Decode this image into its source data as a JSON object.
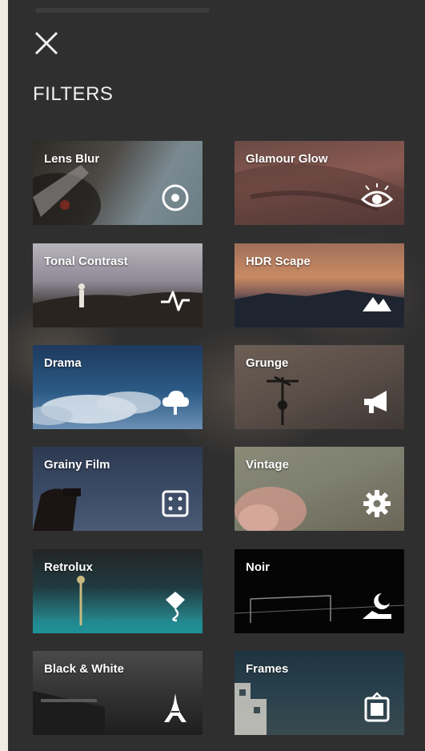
{
  "header": {
    "title": "FILTERS"
  },
  "filters": [
    {
      "label": "Lens Blur",
      "icon": "target-icon"
    },
    {
      "label": "Glamour Glow",
      "icon": "eye-icon"
    },
    {
      "label": "Tonal Contrast",
      "icon": "pulse-icon"
    },
    {
      "label": "HDR Scape",
      "icon": "mountains-icon"
    },
    {
      "label": "Drama",
      "icon": "cloud-icon"
    },
    {
      "label": "Grunge",
      "icon": "megaphone-icon"
    },
    {
      "label": "Grainy Film",
      "icon": "dice-icon"
    },
    {
      "label": "Vintage",
      "icon": "gear-icon"
    },
    {
      "label": "Retrolux",
      "icon": "balloon-icon"
    },
    {
      "label": "Noir",
      "icon": "moon-icon"
    },
    {
      "label": "Black & White",
      "icon": "eiffel-tower-icon"
    },
    {
      "label": "Frames",
      "icon": "frame-icon"
    }
  ]
}
